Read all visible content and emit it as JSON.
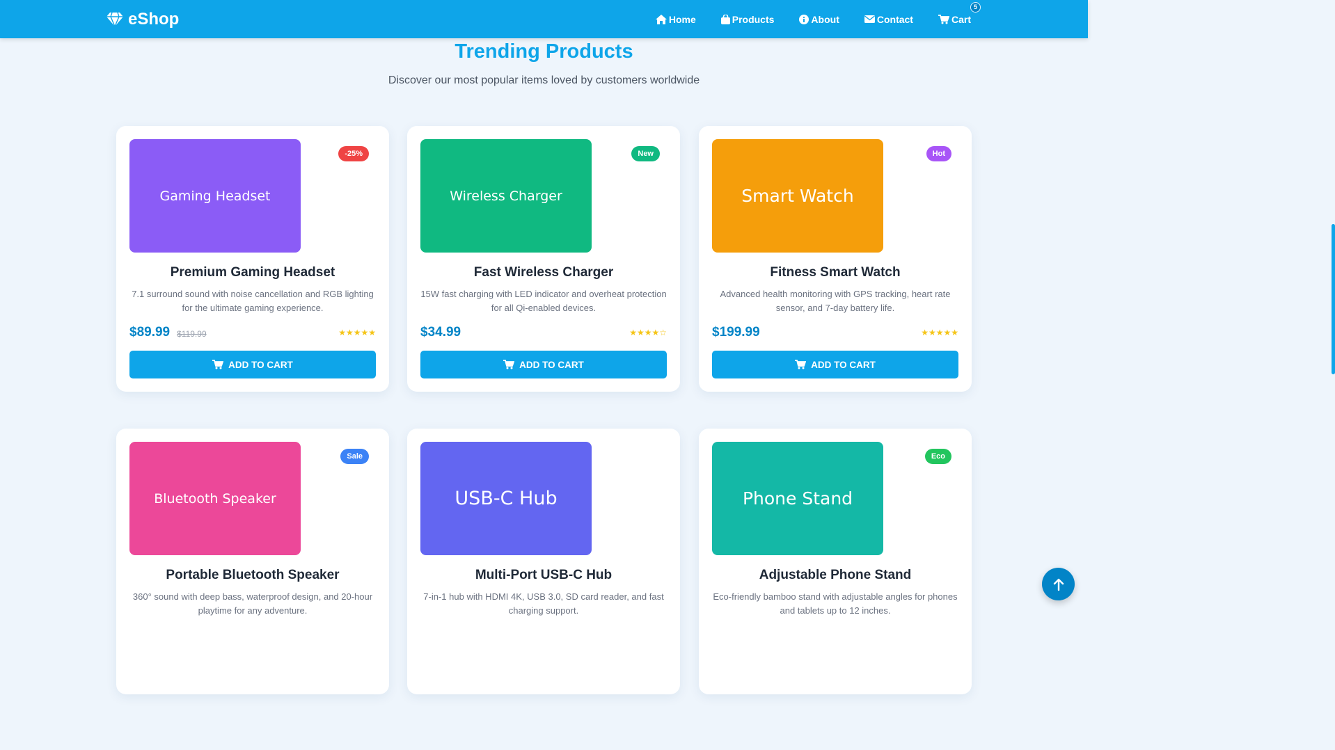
{
  "brand": {
    "name": "eShop",
    "icon": "gem-icon"
  },
  "nav": [
    {
      "label": "Home",
      "icon": "home-icon"
    },
    {
      "label": "Products",
      "icon": "bag-icon"
    },
    {
      "label": "About",
      "icon": "info-icon"
    },
    {
      "label": "Contact",
      "icon": "envelope-icon"
    },
    {
      "label": "Cart",
      "icon": "cart-icon",
      "badge": "5"
    }
  ],
  "section": {
    "title": "Trending Products",
    "subtitle": "Discover our most popular items loved by customers worldwide"
  },
  "colors": {
    "primary": "#0ea5e9",
    "price": "#0284c7"
  },
  "products": [
    {
      "thumb_text": "Gaming Headset",
      "thumb_color": "#8b5cf6",
      "tag": "-25%",
      "tag_color": "#ef4444",
      "title": "Premium Gaming Headset",
      "desc": "7.1 surround sound with noise cancellation and RGB lighting for the ultimate gaming experience.",
      "price": "$89.99",
      "old_price": "$119.99",
      "stars": "★★★★★",
      "rating": 5,
      "button": "ADD TO CART"
    },
    {
      "thumb_text": "Wireless Charger",
      "thumb_color": "#10b981",
      "tag": "New",
      "tag_color": "#10b981",
      "title": "Fast Wireless Charger",
      "desc": "15W fast charging with LED indicator and overheat protection for all Qi-enabled devices.",
      "price": "$34.99",
      "old_price": "",
      "stars": "★★★★☆",
      "rating": 4.5,
      "button": "ADD TO CART"
    },
    {
      "thumb_text": "Smart Watch",
      "thumb_color": "#f59e0b",
      "tag": "Hot",
      "tag_color": "#a855f7",
      "title": "Fitness Smart Watch",
      "desc": "Advanced health monitoring with GPS tracking, heart rate sensor, and 7-day battery life.",
      "price": "$199.99",
      "old_price": "",
      "stars": "★★★★★",
      "rating": 5,
      "button": "ADD TO CART"
    },
    {
      "thumb_text": "Bluetooth Speaker",
      "thumb_color": "#ec4899",
      "tag": "Sale",
      "tag_color": "#3b82f6",
      "title": "Portable Bluetooth Speaker",
      "desc": "360° sound with deep bass, waterproof design, and 20-hour playtime for any adventure.",
      "price": "",
      "old_price": "",
      "stars": "",
      "button": ""
    },
    {
      "thumb_text": "USB-C Hub",
      "thumb_color": "#6366f1",
      "tag": "",
      "tag_color": "",
      "title": "Multi-Port USB-C Hub",
      "desc": "7-in-1 hub with HDMI 4K, USB 3.0, SD card reader, and fast charging support.",
      "price": "",
      "old_price": "",
      "stars": "",
      "button": ""
    },
    {
      "thumb_text": "Phone Stand",
      "thumb_color": "#14b8a6",
      "tag": "Eco",
      "tag_color": "#22c55e",
      "title": "Adjustable Phone Stand",
      "desc": "Eco-friendly bamboo stand with adjustable angles for phones and tablets up to 12 inches.",
      "price": "",
      "old_price": "",
      "stars": "",
      "button": ""
    }
  ],
  "fab": {
    "icon": "arrow-up-icon"
  }
}
